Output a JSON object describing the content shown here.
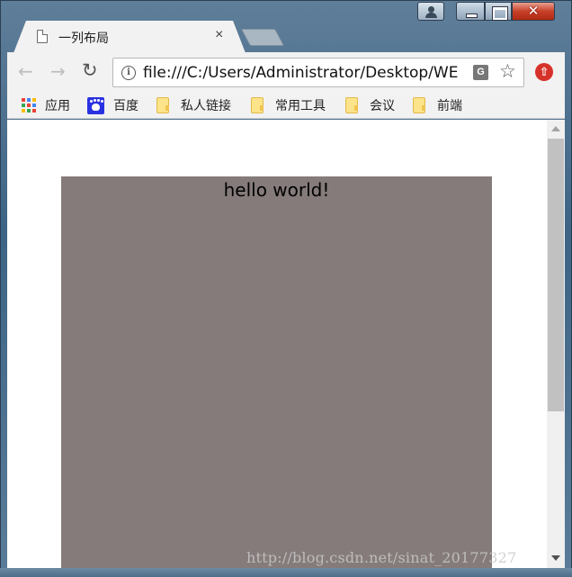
{
  "tab": {
    "title": "一列布局",
    "close": "×"
  },
  "window": {
    "close": "✕"
  },
  "toolbar": {
    "back": "←",
    "forward": "→",
    "reload": "↻",
    "url": "file:///C:/Users/Administrator/Desktop/WE",
    "info": "i",
    "translate": "G",
    "star": "☆",
    "extension": "⇧"
  },
  "bookmarks": [
    {
      "label": "应用",
      "icon": "apps-grid-icon"
    },
    {
      "label": "百度",
      "icon": "baidu-paw-icon"
    },
    {
      "label": "私人链接",
      "icon": "folder-icon"
    },
    {
      "label": "常用工具",
      "icon": "folder-icon"
    },
    {
      "label": "会议",
      "icon": "folder-icon"
    },
    {
      "label": "前端",
      "icon": "folder-icon"
    }
  ],
  "page": {
    "box_text": "hello world!",
    "box_color": "#857b7b"
  },
  "watermark": "http://blog.csdn.net/sinat_20177327",
  "colors": {
    "close_button": "#c8402a",
    "extension_icon": "#d6322a",
    "baidu": "#2932e1"
  }
}
